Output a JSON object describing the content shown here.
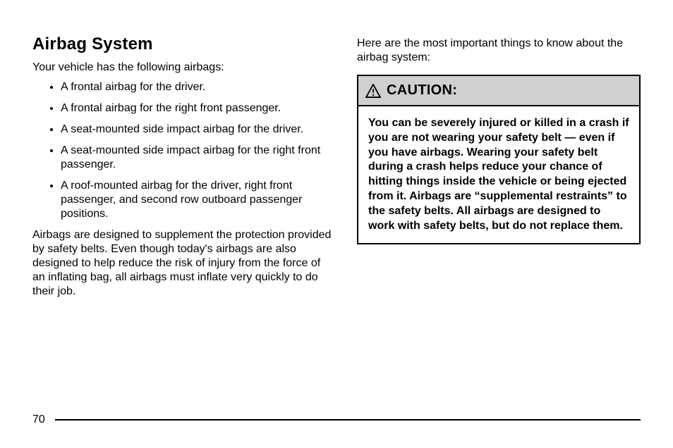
{
  "left": {
    "heading": "Airbag System",
    "intro": "Your vehicle has the following airbags:",
    "bullets": [
      "A frontal airbag for the driver.",
      "A frontal airbag for the right front passenger.",
      "A seat-mounted side impact airbag for the driver.",
      "A seat-mounted side impact airbag for the right front passenger.",
      "A roof-mounted airbag for the driver, right front passenger, and second row outboard passenger positions."
    ],
    "para1": "Airbags are designed to supplement the protection provided by safety belts. Even though today's airbags are also designed to help reduce the risk of injury from the force of an inflating bag, all airbags must inflate very quickly to do their job."
  },
  "right": {
    "intro": "Here are the most important things to know about the airbag system:",
    "cautionLabel": "CAUTION:",
    "cautionBody": "You can be severely injured or killed in a crash if you are not wearing your safety belt — even if you have airbags. Wearing your safety belt during a crash helps reduce your chance of hitting things inside the vehicle or being ejected from it. Airbags are “supplemental restraints” to the safety belts. All airbags are designed to work with safety belts, but do not replace them."
  },
  "pageNumber": "70"
}
